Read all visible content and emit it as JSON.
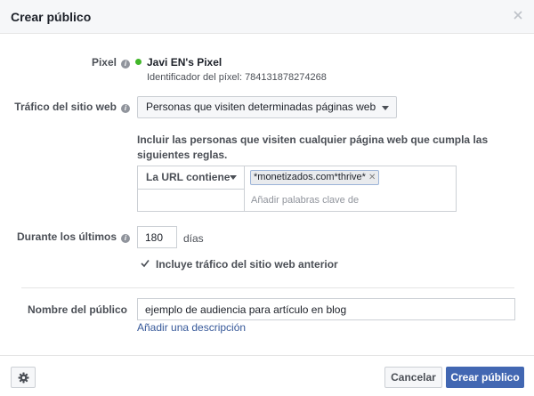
{
  "dialog": {
    "title": "Crear público"
  },
  "pixel": {
    "label": "Pixel",
    "info_icon": "i",
    "status_color": "#42b72a",
    "name": "Javi EN's Pixel",
    "id_text": "Identificador del píxel: 784131878274268"
  },
  "traffic": {
    "label": "Tráfico del sitio web",
    "info_icon": "i",
    "selected": "Personas que visiten determinadas páginas web"
  },
  "rules": {
    "description": "Incluir las personas que visiten cualquier página web que cumpla las siguientes reglas.",
    "condition": "La URL contiene",
    "keyword_chip": "*monetizados.com*thrive*",
    "keyword_placeholder": "Añadir palabras clave de"
  },
  "duration": {
    "label": "Durante los últimos",
    "info_icon": "i",
    "value": "180",
    "unit": "días"
  },
  "include_previous": {
    "checked": true,
    "label": "Incluye tráfico del sitio web anterior"
  },
  "audience_name": {
    "label": "Nombre del público",
    "value": "ejemplo de audiencia para artículo en blog",
    "add_description": "Añadir una descripción"
  },
  "footer": {
    "cancel_label": "Cancelar",
    "create_label": "Crear público"
  },
  "colors": {
    "primary": "#4267b2",
    "link": "#365899",
    "header_bg": "#f6f7f9"
  },
  "icons": {
    "close": "close-icon",
    "settings": "gear-icon",
    "info": "info-icon",
    "dropdown": "chevron-down-icon",
    "check": "checkmark-icon",
    "chip_remove": "close-icon"
  }
}
